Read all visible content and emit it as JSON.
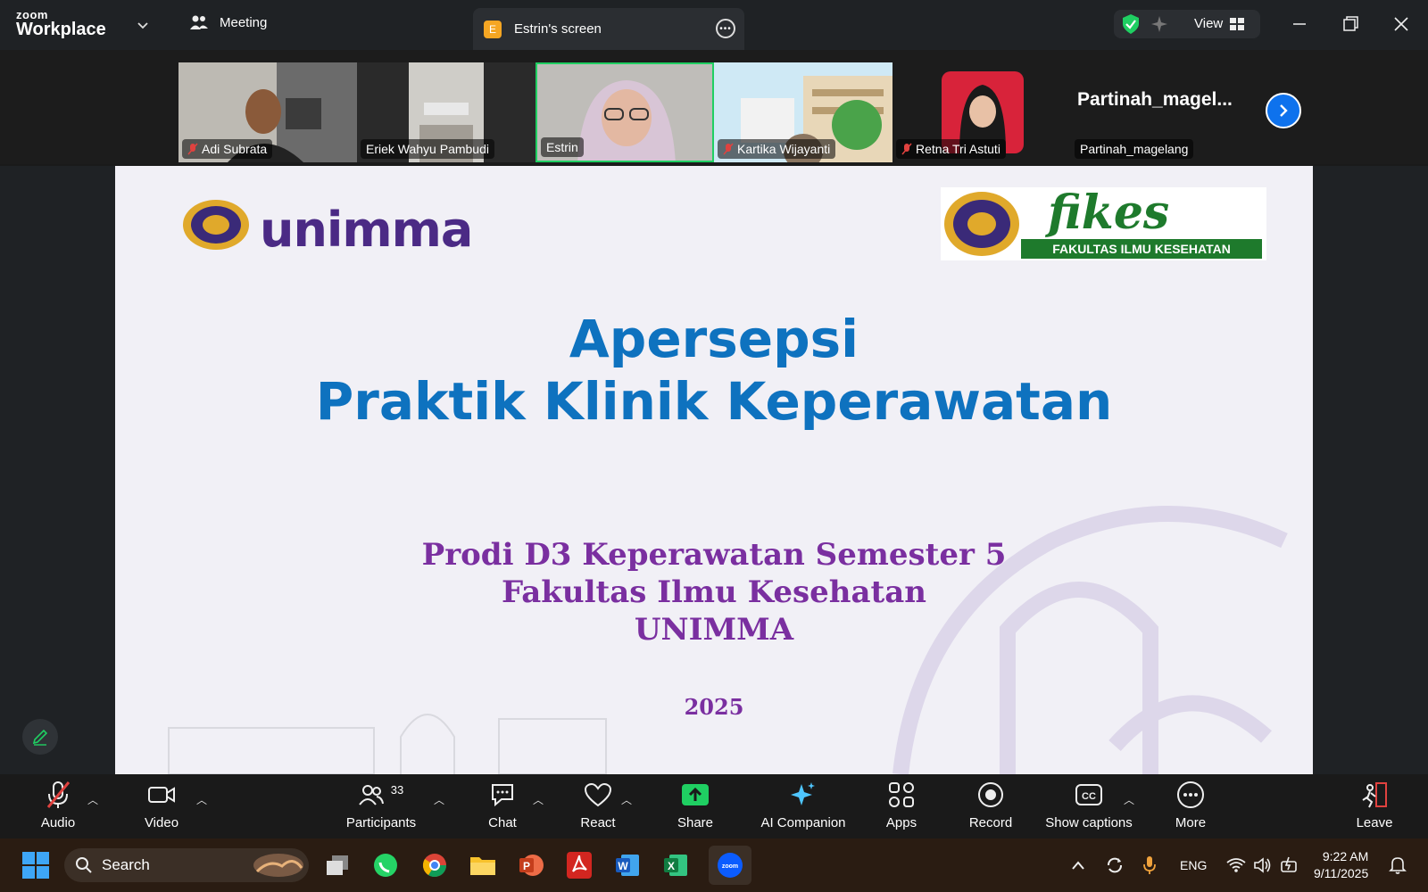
{
  "app": {
    "brand_top": "zoom",
    "brand_bottom": "Workplace"
  },
  "header": {
    "meeting_label": "Meeting",
    "screen_tab_badge": "E",
    "screen_tab_label": "Estrin's screen",
    "view_label": "View"
  },
  "participants": [
    {
      "name": "Adi Subrata",
      "muted": true
    },
    {
      "name": "Eriek Wahyu Pambudi",
      "muted": false
    },
    {
      "name": "Estrin",
      "muted": false,
      "active_speaker": true
    },
    {
      "name": "Kartika Wijayanti",
      "muted": true
    },
    {
      "name": "Retna Tri Astuti",
      "muted": true
    },
    {
      "name": "Partinah_magelang",
      "muted": false,
      "display_big": "Partinah_magel..."
    }
  ],
  "slide": {
    "logo_left_text": "unimma",
    "logo_right_text": "fikes",
    "logo_right_sub": "FAKULTAS ILMU KESEHATAN",
    "title_line1": "Apersepsi",
    "title_line2": "Praktik Klinik Keperawatan",
    "sub_line1": "Prodi D3 Keperawatan Semester 5",
    "sub_line2": "Fakultas Ilmu Kesehatan",
    "sub_line3": "UNIMMA",
    "year": "2025"
  },
  "toolbar": {
    "audio": "Audio",
    "video": "Video",
    "participants": "Participants",
    "participants_count": "33",
    "chat": "Chat",
    "react": "React",
    "share": "Share",
    "ai_companion": "AI Companion",
    "apps": "Apps",
    "record": "Record",
    "show_captions": "Show captions",
    "more": "More",
    "leave": "Leave"
  },
  "taskbar": {
    "search_placeholder": "Search",
    "language": "ENG",
    "time": "9:22 AM",
    "date": "9/11/2025"
  },
  "colors": {
    "accent": "#0e72ed",
    "share_green": "#1fcf62",
    "muted_red": "#e0423f",
    "slide_title": "#0e72bf",
    "slide_sub": "#7a2fa0"
  }
}
